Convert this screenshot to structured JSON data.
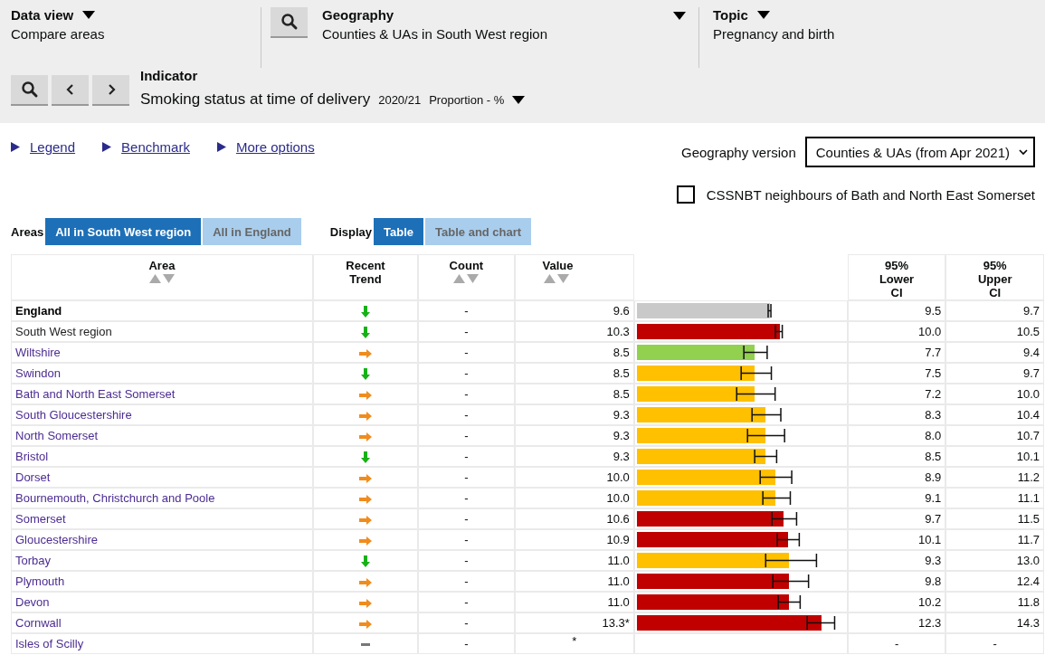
{
  "header": {
    "data_view": {
      "label": "Data view",
      "value": "Compare areas"
    },
    "geography": {
      "label": "Geography",
      "value": "Counties & UAs in South West region"
    },
    "topic": {
      "label": "Topic",
      "value": "Pregnancy and birth"
    },
    "indicator": {
      "label": "Indicator",
      "name": "Smoking status at time of delivery",
      "period": "2020/21",
      "unit": "Proportion - %"
    }
  },
  "links": [
    "Legend",
    "Benchmark",
    "More options"
  ],
  "geography_version": {
    "label": "Geography version",
    "value": "Counties & UAs (from Apr 2021)"
  },
  "neighbours": {
    "label": "CSSNBT neighbours of Bath and North East Somerset",
    "checked": false
  },
  "areas": {
    "label": "Areas",
    "options": [
      {
        "label": "All in South West region",
        "selected": true
      },
      {
        "label": "All in England",
        "selected": false
      }
    ]
  },
  "display": {
    "label": "Display",
    "options": [
      {
        "label": "Table",
        "selected": true
      },
      {
        "label": "Table and chart",
        "selected": false
      }
    ]
  },
  "table": {
    "columns": [
      "Area",
      "Recent Trend",
      "Count",
      "Value",
      "95% Lower CI",
      "95% Upper CI"
    ],
    "rows": [
      {
        "area": "England",
        "kind": "benchmark",
        "trend": {
          "kind": "down"
        },
        "count": "-",
        "value": "9.6",
        "color": "#c9c9c9",
        "lower": "9.5",
        "upper": "9.7"
      },
      {
        "area": "South West region",
        "kind": "parent",
        "trend": {
          "kind": "down"
        },
        "count": "-",
        "value": "10.3",
        "color": "#c00000",
        "lower": "10.0",
        "upper": "10.5"
      },
      {
        "area": "Wiltshire",
        "kind": "area",
        "trend": {
          "kind": "right"
        },
        "count": "-",
        "value": "8.5",
        "color": "#92d050",
        "lower": "7.7",
        "upper": "9.4"
      },
      {
        "area": "Swindon",
        "kind": "area",
        "trend": {
          "kind": "down"
        },
        "count": "-",
        "value": "8.5",
        "color": "#ffc000",
        "lower": "7.5",
        "upper": "9.7"
      },
      {
        "area": "Bath and North East Somerset",
        "kind": "area",
        "trend": {
          "kind": "right"
        },
        "count": "-",
        "value": "8.5",
        "color": "#ffc000",
        "lower": "7.2",
        "upper": "10.0"
      },
      {
        "area": "South Gloucestershire",
        "kind": "area",
        "trend": {
          "kind": "right"
        },
        "count": "-",
        "value": "9.3",
        "color": "#ffc000",
        "lower": "8.3",
        "upper": "10.4"
      },
      {
        "area": "North Somerset",
        "kind": "area",
        "trend": {
          "kind": "right"
        },
        "count": "-",
        "value": "9.3",
        "color": "#ffc000",
        "lower": "8.0",
        "upper": "10.7"
      },
      {
        "area": "Bristol",
        "kind": "area",
        "trend": {
          "kind": "down"
        },
        "count": "-",
        "value": "9.3",
        "color": "#ffc000",
        "lower": "8.5",
        "upper": "10.1"
      },
      {
        "area": "Dorset",
        "kind": "area",
        "trend": {
          "kind": "right"
        },
        "count": "-",
        "value": "10.0",
        "color": "#ffc000",
        "lower": "8.9",
        "upper": "11.2"
      },
      {
        "area": "Bournemouth, Christchurch and Poole",
        "kind": "area",
        "trend": {
          "kind": "right"
        },
        "count": "-",
        "value": "10.0",
        "color": "#ffc000",
        "lower": "9.1",
        "upper": "11.1"
      },
      {
        "area": "Somerset",
        "kind": "area",
        "trend": {
          "kind": "right"
        },
        "count": "-",
        "value": "10.6",
        "color": "#c00000",
        "lower": "9.7",
        "upper": "11.5"
      },
      {
        "area": "Gloucestershire",
        "kind": "area",
        "trend": {
          "kind": "right"
        },
        "count": "-",
        "value": "10.9",
        "color": "#c00000",
        "lower": "10.1",
        "upper": "11.7"
      },
      {
        "area": "Torbay",
        "kind": "area",
        "trend": {
          "kind": "down"
        },
        "count": "-",
        "value": "11.0",
        "color": "#ffc000",
        "lower": "9.3",
        "upper": "13.0"
      },
      {
        "area": "Plymouth",
        "kind": "area",
        "trend": {
          "kind": "right"
        },
        "count": "-",
        "value": "11.0",
        "color": "#c00000",
        "lower": "9.8",
        "upper": "12.4"
      },
      {
        "area": "Devon",
        "kind": "area",
        "trend": {
          "kind": "right"
        },
        "count": "-",
        "value": "11.0",
        "color": "#c00000",
        "lower": "10.2",
        "upper": "11.8"
      },
      {
        "area": "Cornwall",
        "kind": "area",
        "trend": {
          "kind": "right"
        },
        "count": "-",
        "value": "13.3*",
        "color": "#c00000",
        "lower": "12.3",
        "upper": "14.3"
      },
      {
        "area": "Isles of Scilly",
        "kind": "area",
        "trend": {
          "kind": "none"
        },
        "count": "-",
        "value": "*",
        "lower": "-",
        "upper": "-"
      }
    ]
  }
}
